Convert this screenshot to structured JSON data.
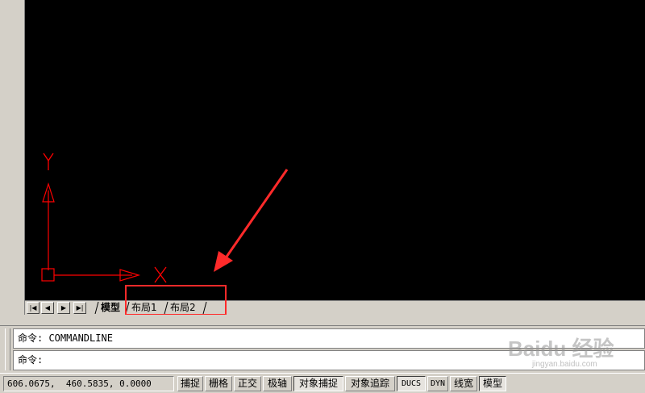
{
  "canvas": {
    "background": "#000000",
    "ucs_color": "#ff0000",
    "axis_y_label": "Y",
    "axis_x_label": "X"
  },
  "annotation": {
    "color": "#ff2a2a",
    "arrow": "pointing-to-layout-tabs",
    "highlight": "rectangle-around-layout-tabs"
  },
  "tabs": {
    "nav_icons": [
      "first-tab-icon",
      "prev-tab-icon",
      "next-tab-icon",
      "last-tab-icon"
    ],
    "nav_glyphs": [
      "|◀",
      "◀",
      "▶",
      "▶|"
    ],
    "items": [
      {
        "label": "模型",
        "active": true
      },
      {
        "label": "布局1",
        "active": false
      },
      {
        "label": "布局2",
        "active": false
      }
    ]
  },
  "command": {
    "history_line": "命令: COMMANDLINE",
    "prompt_line": "命令:"
  },
  "status": {
    "coordinates": "606.0675,  460.5835, 0.0000",
    "buttons": [
      {
        "label": "捕捉",
        "on": false
      },
      {
        "label": "栅格",
        "on": false
      },
      {
        "label": "正交",
        "on": false
      },
      {
        "label": "极轴",
        "on": false
      },
      {
        "label": "对象捕捉",
        "on": true
      },
      {
        "label": "对象追踪",
        "on": false
      },
      {
        "label": "DUCS",
        "on": true
      },
      {
        "label": "DYN",
        "on": false
      },
      {
        "label": "线宽",
        "on": false
      },
      {
        "label": "模型",
        "on": true
      }
    ]
  },
  "watermark": {
    "text": "Baidu 经验",
    "url": "jingyan.baidu.com"
  }
}
